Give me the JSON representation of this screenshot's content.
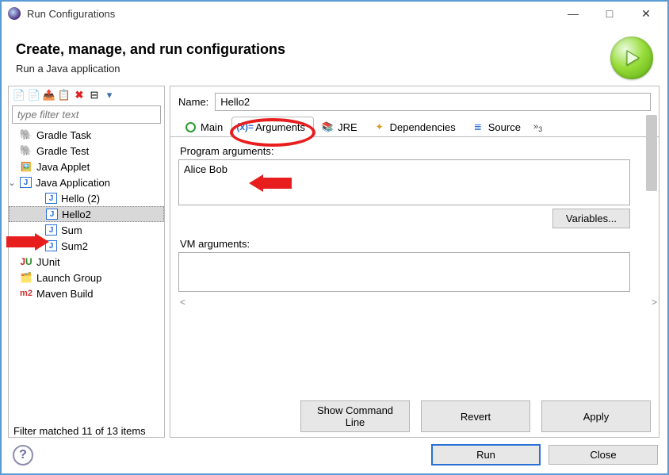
{
  "window": {
    "title": "Run Configurations"
  },
  "header": {
    "title": "Create, manage, and run configurations",
    "subtitle": "Run a Java application"
  },
  "sidebar": {
    "filter_placeholder": "type filter text",
    "items": [
      {
        "label": "Gradle Task",
        "icon": "elephant-icon"
      },
      {
        "label": "Gradle Test",
        "icon": "elephant-icon"
      },
      {
        "label": "Java Applet",
        "icon": "applet-icon"
      },
      {
        "label": "Java Application",
        "icon": "j-icon",
        "expanded": true,
        "children": [
          {
            "label": "Hello (2)"
          },
          {
            "label": "Hello2",
            "selected": true
          },
          {
            "label": "Sum"
          },
          {
            "label": "Sum2"
          }
        ]
      },
      {
        "label": "JUnit",
        "icon": "junit-icon"
      },
      {
        "label": "Launch Group",
        "icon": "launch-group-icon"
      },
      {
        "label": "Maven Build",
        "icon": "maven-icon"
      }
    ],
    "status": "Filter matched 11 of 13 items"
  },
  "main": {
    "name_label": "Name:",
    "name_value": "Hello2",
    "tabs": [
      {
        "label": "Main"
      },
      {
        "label": "Arguments",
        "active": true
      },
      {
        "label": "JRE"
      },
      {
        "label": "Dependencies"
      },
      {
        "label": "Source"
      }
    ],
    "overflow": "»",
    "overflow_count": "3",
    "program_args_label": "Program arguments:",
    "program_args_value": "Alice Bob",
    "variables_button": "Variables...",
    "vm_args_label": "VM arguments:",
    "vm_args_value": "",
    "buttons": {
      "show_cmd": "Show Command Line",
      "revert": "Revert",
      "apply": "Apply"
    }
  },
  "footer": {
    "run": "Run",
    "close": "Close"
  }
}
